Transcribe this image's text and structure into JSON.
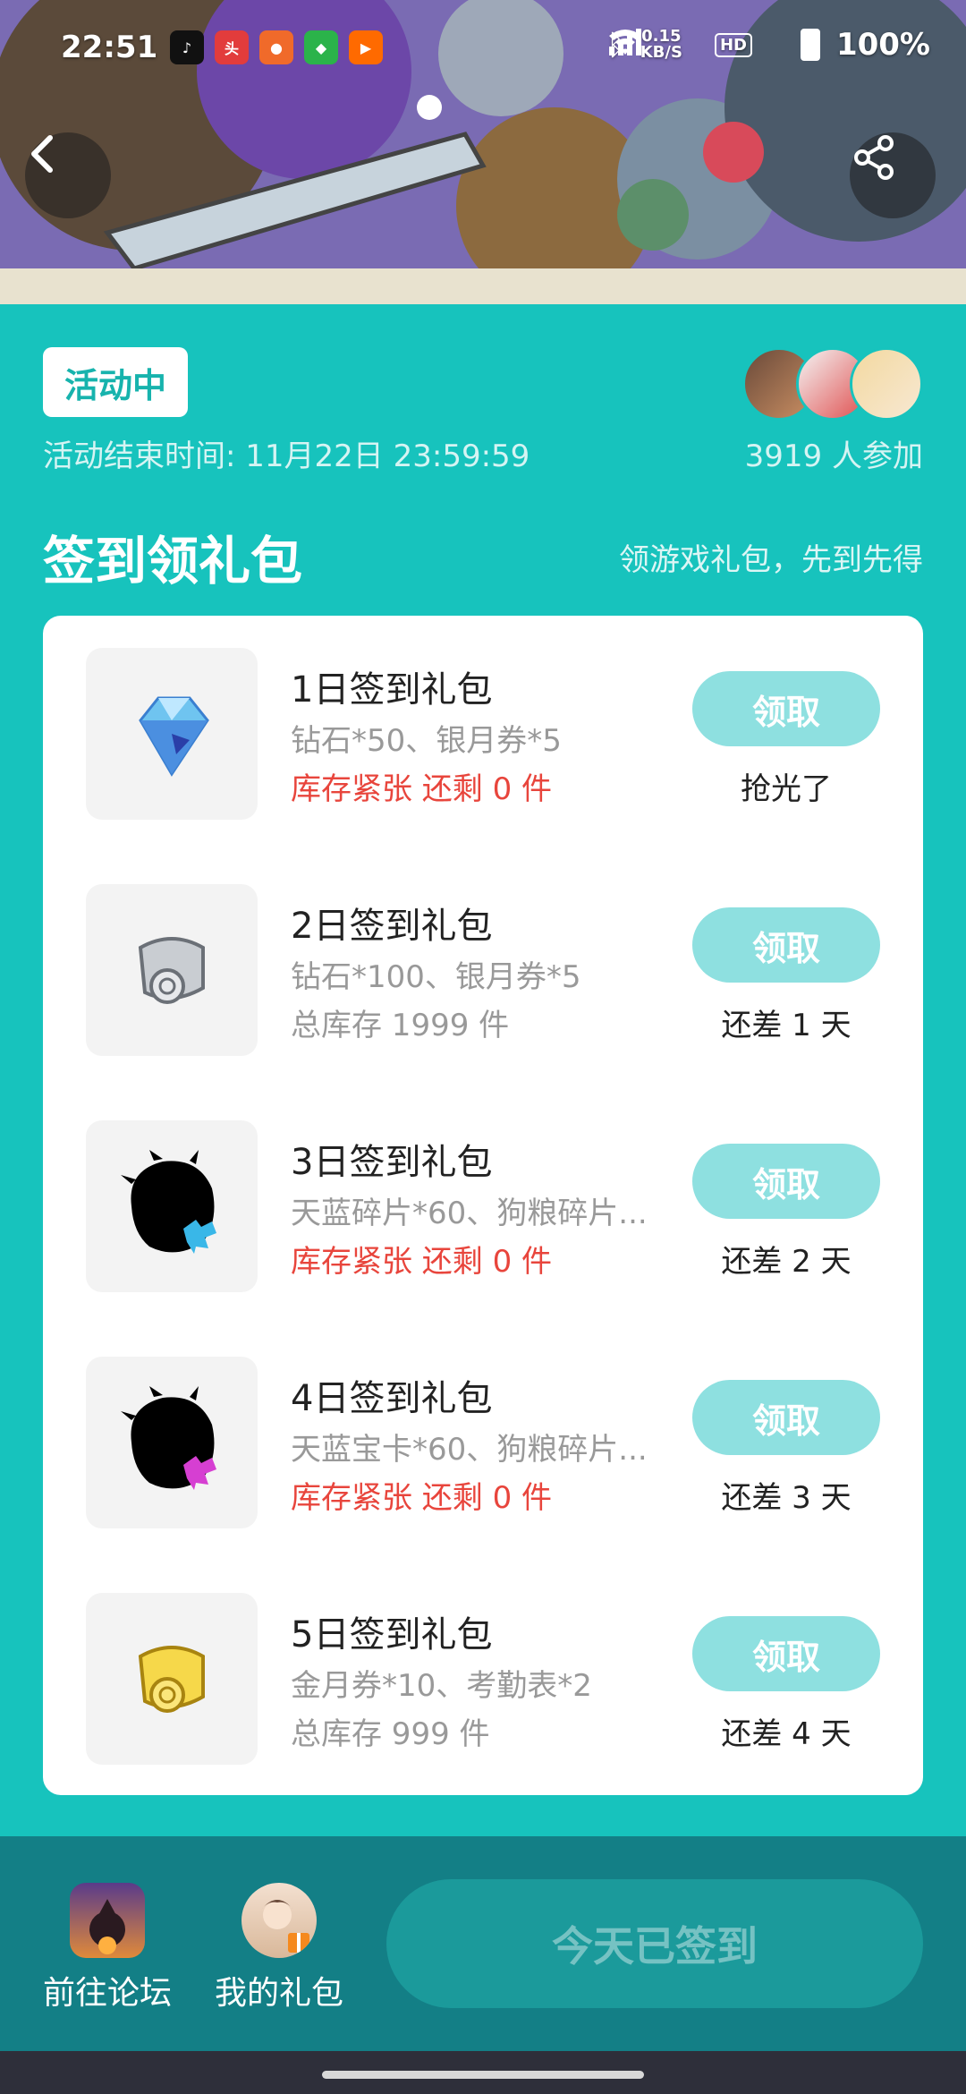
{
  "status_bar": {
    "time": "22:51",
    "net_speed_value": "0.15",
    "net_speed_unit": "KB/S",
    "hd_label": "HD",
    "battery": "100%"
  },
  "activity": {
    "status_badge": "活动中",
    "end_time": "活动结束时间: 11月22日 23:59:59",
    "participants": "3919 人参加"
  },
  "section": {
    "title": "签到领礼包",
    "subtitle": "领游戏礼包，先到先得"
  },
  "gifts": [
    {
      "name": "1日签到礼包",
      "desc": "钻石*50、银月券*5",
      "stock": "库存紧张 还剩 0 件",
      "stock_warn": true,
      "button": "领取",
      "note": "抢光了",
      "icon": "diamond-icon"
    },
    {
      "name": "2日签到礼包",
      "desc": "钻石*100、银月券*5",
      "stock": "总库存 1999 件",
      "stock_warn": false,
      "button": "领取",
      "note": "还差 1 天",
      "icon": "silver-scroll-icon"
    },
    {
      "name": "3日签到礼包",
      "desc": "天蓝碎片*60、狗粮碎片...",
      "stock": "库存紧张 还剩 0 件",
      "stock_warn": true,
      "button": "领取",
      "note": "还差 2 天",
      "icon": "blue-shard-silhouette-icon"
    },
    {
      "name": "4日签到礼包",
      "desc": "天蓝宝卡*60、狗粮碎片...",
      "stock": "库存紧张 还剩 0 件",
      "stock_warn": true,
      "button": "领取",
      "note": "还差 3 天",
      "icon": "pink-shard-silhouette-icon"
    },
    {
      "name": "5日签到礼包",
      "desc": "金月券*10、考勤表*2",
      "stock": "总库存 999 件",
      "stock_warn": false,
      "button": "领取",
      "note": "还差 4 天",
      "icon": "gold-scroll-icon"
    }
  ],
  "bottom": {
    "forum_label": "前往论坛",
    "my_gifts_label": "我的礼包",
    "signed_button": "今天已签到"
  },
  "colors": {
    "accent": "#17c3bd",
    "bottom_bar": "#137f86",
    "warn": "#e8453c",
    "claim_disabled": "#8ee0e0"
  }
}
